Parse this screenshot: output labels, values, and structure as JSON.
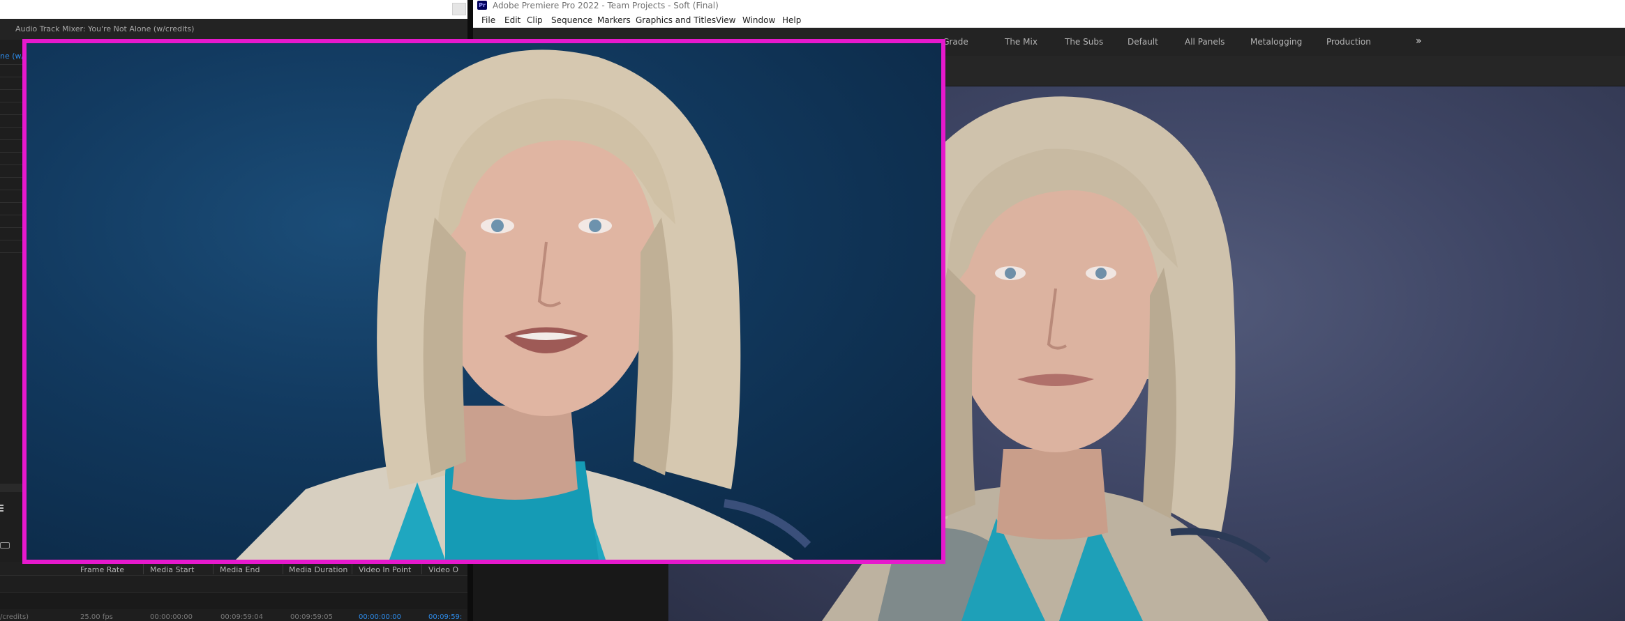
{
  "left_window": {
    "mixer_title": "Audio Track Mixer: You're Not Alone (w/credits)",
    "mixer_tab_label": "ne (w/",
    "columns": [
      "Frame Rate",
      "Media Start",
      "Media End",
      "Media Duration",
      "Video In Point",
      "Video O"
    ],
    "row": {
      "name": "/credits)",
      "frame_rate": "25.00 fps",
      "media_start": "00:00:00:00",
      "media_end": "00:09:59:04",
      "media_duration": "00:09:59:05",
      "video_in_point": "00:00:00:00",
      "video_out_point": "00:09:59:"
    }
  },
  "premiere": {
    "logo": "Pr",
    "title": "Adobe Premiere Pro 2022 - Team Projects - Soft (Final)",
    "menu": [
      "File",
      "Edit",
      "Clip",
      "Sequence",
      "Markers",
      "Graphics and Titles",
      "View",
      "Window",
      "Help"
    ],
    "workspaces": [
      "e Grade",
      "The Mix",
      "The Subs",
      "Default",
      "All Panels",
      "Metalogging",
      "Production"
    ],
    "more_symbol": "»"
  },
  "colors": {
    "highlight_border": "#e619cd",
    "timecode_blue": "#2d8ceb",
    "panel_bg": "#1f1f1f"
  }
}
